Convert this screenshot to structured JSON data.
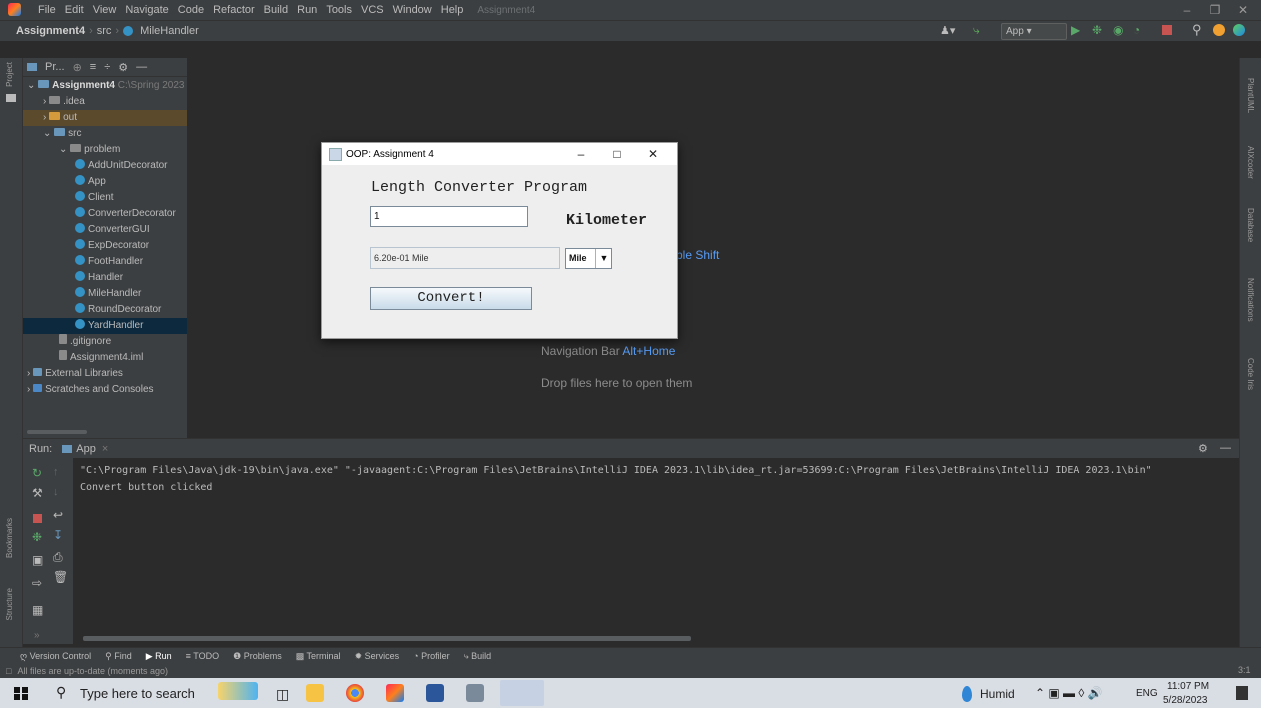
{
  "menu": [
    "File",
    "Edit",
    "View",
    "Navigate",
    "Code",
    "Refactor",
    "Build",
    "Run",
    "Tools",
    "VCS",
    "Window",
    "Help"
  ],
  "title_project": "Assignment4",
  "breadcrumb": {
    "project": "Assignment4",
    "src": "src",
    "file": "MileHandler"
  },
  "run_config": "App",
  "project_panel": {
    "title": "Pr...",
    "root_name": "Assignment4",
    "root_path": "C:\\Spring 2023",
    "items": [
      ".idea",
      "out",
      "src",
      "problem",
      "AddUnitDecorator",
      "App",
      "Client",
      "ConverterDecorator",
      "ConverterGUI",
      "ExpDecorator",
      "FootHandler",
      "Handler",
      "MileHandler",
      "RoundDecorator",
      "YardHandler",
      ".gitignore",
      "Assignment4.iml",
      "External Libraries",
      "Scratches and Consoles"
    ]
  },
  "editor_hints": {
    "double_shift_partial": "ble Shift",
    "nav_label": "Navigation Bar",
    "nav_key": "Alt+Home",
    "drop": "Drop files here to open them"
  },
  "dialog": {
    "title": "OOP: Assignment 4",
    "heading": "Length Converter Program",
    "input_value": "1",
    "unit_from": "Kilometer",
    "result": "6.20e-01 Mile",
    "unit_to": "Mile",
    "button": "Convert!"
  },
  "run_panel": {
    "label": "Run:",
    "tab": "App",
    "cmd": "\"C:\\Program Files\\Java\\jdk-19\\bin\\java.exe\" \"-javaagent:C:\\Program Files\\JetBrains\\IntelliJ IDEA 2023.1\\lib\\idea_rt.jar=53699:C:\\Program Files\\JetBrains\\IntelliJ IDEA 2023.1\\bin\"",
    "output": "Convert button clicked"
  },
  "bottom_tabs": [
    "Version Control",
    "Find",
    "Run",
    "TODO",
    "Problems",
    "Terminal",
    "Services",
    "Profiler",
    "Build"
  ],
  "status": {
    "message": "All files are up-to-date (moments ago)",
    "position": "3:1"
  },
  "side_labels": {
    "left": [
      "Project",
      "Bookmarks",
      "Structure"
    ],
    "right": [
      "PlantUML",
      "AIXcoder",
      "Database",
      "Notifications",
      "Code Iris"
    ]
  },
  "taskbar": {
    "search": "Type here to search",
    "weather": "Humid",
    "lang": "ENG",
    "time": "11:07 PM",
    "date": "5/28/2023"
  }
}
